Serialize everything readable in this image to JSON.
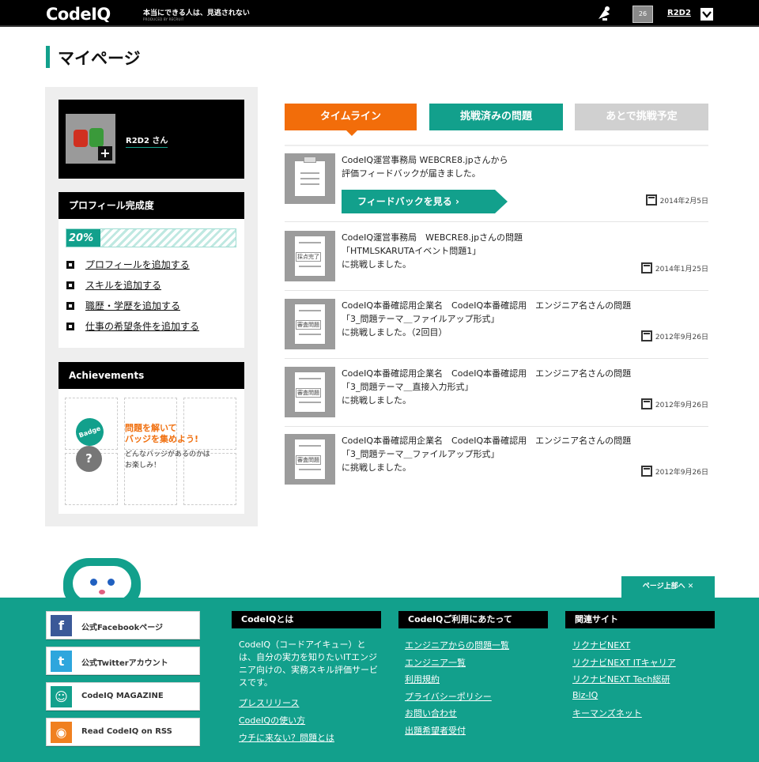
{
  "header": {
    "logo": "CodeIQ",
    "tagline": "本当にできる人は、見逃されない",
    "produced_by": "PRODUCED BY RECRUIT",
    "avatar_text": "26",
    "username": "R2D2"
  },
  "page": {
    "title": "マイページ"
  },
  "sidebar": {
    "profile": {
      "name": "R2D2 さん"
    },
    "completion": {
      "title": "プロフィール完成度",
      "percent_label": "20%",
      "percent": 20,
      "todos": [
        "プロフィールを追加する",
        "スキルを追加する",
        "職歴・学歴を追加する",
        "仕事の希望条件を追加する"
      ]
    },
    "achievements": {
      "title": "Achievements",
      "badge_text": "Badge",
      "question_mark": "?",
      "headline_1": "問題を解いて",
      "headline_2": "バッジを集めよう!",
      "sub_1": "どんなバッジがあるのかは",
      "sub_2": "お楽しみ！"
    }
  },
  "tabs": [
    {
      "label": "タイムライン",
      "active": true
    },
    {
      "label": "挑戦済みの問題",
      "active": false
    },
    {
      "label": "あとで挑戦予定",
      "active": false
    }
  ],
  "timeline": [
    {
      "line1": "CodeIQ運営事務局 WEBCRE8.jpさんから",
      "line2": "評価フィードバックが届きました。",
      "line3": "",
      "thumb_label": "",
      "date": "2014年2月5日",
      "button": "フィードバックを見る ›"
    },
    {
      "line1": "CodeIQ運営事務局　WEBCRE8.jpさんの問題",
      "line2": "「HTMLSKARUTAイベント問題1」",
      "line3": "に挑戦しました。",
      "thumb_label": "採点完了",
      "date": "2014年1月25日"
    },
    {
      "line1": "CodeIQ本番確認用企業名　CodeIQ本番確認用　エンジニア名さんの問題",
      "line2": "「3_問題テーマ＿ファイルアップ形式」",
      "line3": "に挑戦しました。（2回目）",
      "thumb_label": "審査問題",
      "date": "2012年9月26日"
    },
    {
      "line1": "CodeIQ本番確認用企業名　CodeIQ本番確認用　エンジニア名さんの問題",
      "line2": "「3_問題テーマ＿直接入力形式」",
      "line3": "に挑戦しました。",
      "thumb_label": "審査問題",
      "date": "2012年9月26日"
    },
    {
      "line1": "CodeIQ本番確認用企業名　CodeIQ本番確認用　エンジニア名さんの問題",
      "line2": "「3_問題テーマ＿ファイルアップ形式」",
      "line3": "に挑戦しました。",
      "thumb_label": "審査問題",
      "date": "2012年9月26日"
    }
  ],
  "footer": {
    "page_top": "ページ上部へ ✕",
    "social": [
      {
        "label": "公式Facebookページ",
        "icon": "f",
        "color": "#3b5998"
      },
      {
        "label": "公式Twitterアカウント",
        "icon": "t",
        "color": "#2ea6dd"
      },
      {
        "label": "CodeIQ MAGAZINE",
        "icon": "☺",
        "color": "#12a08c"
      },
      {
        "label": "Read CodeIQ on RSS",
        "icon": "◉",
        "color": "#f08020"
      }
    ],
    "about": {
      "title": "CodeIQとは",
      "desc": "CodeIQ（コードアイキュー）とは、自分の実力を知りたいITエンジニア向けの、実務スキル評価サービスです。",
      "links": [
        "プレスリリース",
        "CodeIQの使い方",
        "ウチに来ない？問題とは"
      ]
    },
    "usage": {
      "title": "CodeIQご利用にあたって",
      "links": [
        "エンジニアからの問題一覧",
        "エンジニア一覧",
        "利用規約",
        "プライバシーポリシー",
        "お問い合わせ",
        "出題希望者受付"
      ]
    },
    "related": {
      "title": "関連サイト",
      "links": [
        "リクナビNEXT",
        "リクナビNEXT ITキャリア",
        "リクナビNEXT Tech総研",
        "Biz-IQ",
        "キーマンズネット"
      ]
    }
  }
}
